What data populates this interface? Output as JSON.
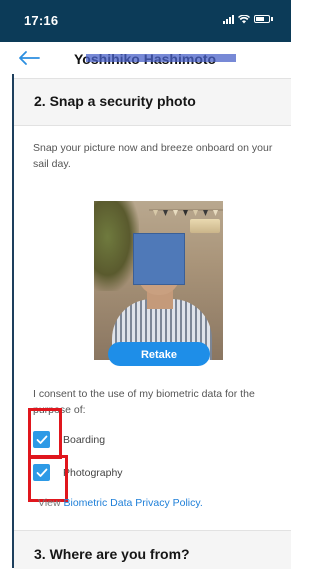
{
  "status_bar": {
    "time": "17:16"
  },
  "header": {
    "title": "Yoshihiko Hashimoto"
  },
  "section_photo": {
    "title": "2. Snap a security photo",
    "description": "Snap your picture now and breeze onboard on your sail day.",
    "retake_label": "Retake"
  },
  "consent": {
    "text": "I consent to the use of my biometric data for the purpose of:",
    "options": [
      {
        "label": "Boarding",
        "checked": true
      },
      {
        "label": "Photography",
        "checked": true
      }
    ],
    "policy_prefix": "View",
    "policy_link": "Biometric Data Privacy Policy."
  },
  "section_origin": {
    "title": "3. Where are you from?"
  },
  "colors": {
    "status_bar": "#0c3b58",
    "accent": "#1e8ee8",
    "highlight": "#e0161d",
    "redaction": "#4a62c8"
  },
  "icons": {
    "back": "arrow-left-icon",
    "signal": "signal-icon",
    "wifi": "wifi-icon",
    "battery": "battery-icon",
    "check": "checkmark-icon"
  }
}
